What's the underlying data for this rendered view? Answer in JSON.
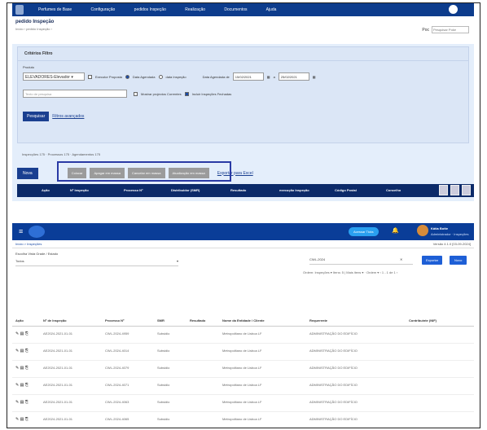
{
  "shot1": {
    "menu": [
      "Perfumes de Base",
      "Configuração",
      "pedidos Inspeção",
      "Realização",
      "Documentos",
      "Ajuda"
    ],
    "page_title": "pedido Inspeção",
    "breadcrumb": "Início › pedido Inspeção ›",
    "poc_label": "Poc",
    "poc_placeholder": "Pesquisar Poke",
    "criteria_title": "Critérios Filtro",
    "produto_label": "Produto",
    "produto_value": "ELEVADORES-Elevador",
    "radio_labels": [
      "Executor Proposta",
      "Data Agendada",
      "data Inspeção"
    ],
    "date_label": "Data Agendada de",
    "date_from": "15/02/2021",
    "date_sep": "a",
    "date_to": "25/02/2021",
    "search_placeholder": "Texto de pesquisa",
    "check_labels": [
      "Mostrar projectos Correntes",
      "Incluir Inspeções Fechadas"
    ],
    "search_button": "Pesquisar",
    "advanced_link": "Filtros avançados",
    "info_text": "Inspecções 175 · Processos 175 · Agendamentos 175",
    "nova_button": "Nova",
    "action_buttons": [
      "Colocar",
      "Apagar em massa",
      "Cancelar em massa",
      "Atualização em massa"
    ],
    "export_link": "Exportar para Excel",
    "columns": [
      "Ação",
      "Nº Inspeção",
      "Processo Nº",
      "Distribuidor (SMR)",
      "Resultado",
      "execução Inspeção",
      "Código Postal",
      "Concelho"
    ]
  },
  "shot2": {
    "account_button": "Acessar Ticks",
    "user_name": "Kátia Botte",
    "user_role": "Administrador · Inspeções",
    "breadcrumb": "Início > Inspeções",
    "version": "Versão 4.1.0 [03-09-2024]",
    "filter_label": "Escolha Vista Grade / Estado",
    "filter_value": "Todos",
    "process_value": "CWL-2024",
    "export_button": "Exportar",
    "new_button": "Novo",
    "pagination": "Ordem: Inspeções ▾  Itens: 5 | Mais itens ▾ · Ordem ▾  ‹ 1 - 1 de 1 ›",
    "columns": [
      "Ação",
      "Nº de Inspeção",
      "Processo Nº",
      "SMR",
      "Resultado",
      "Nome da Entidade / Cliente",
      "Requerente",
      "Contribuinte (NIF)"
    ],
    "rows": [
      [
        "AE2024-2021-01-01",
        "CWL-2024-4959",
        "Subsidio",
        "Metropolitano de Lisboa LF",
        "ADMINISTRAÇÃO DO EDIFÍCIO"
      ],
      [
        "AE2024-2021-01-01",
        "CWL-2024-4014",
        "Subsidio",
        "Metropolitano de Lisboa LF",
        "ADMINISTRAÇÃO DO EDIFÍCIO"
      ],
      [
        "AE2024-2021-01-01",
        "CWL-2024-4079",
        "Subsidio",
        "Metropolitano de Lisboa LF",
        "ADMINISTRAÇÃO DO EDIFÍCIO"
      ],
      [
        "AE2024-2021-01-01",
        "CWL-2024-4071",
        "Subsidio",
        "Metropolitano de Lisboa LF",
        "ADMINISTRAÇÃO DO EDIFÍCIO"
      ],
      [
        "AE2024-2021-01-01",
        "CWL-2024-4063",
        "Subsidio",
        "Metropolitano de Lisboa LF",
        "ADMINISTRAÇÃO DO EDIFÍCIO"
      ],
      [
        "AE2024-2021-01-01",
        "CWL-2024-4065",
        "Subsidio",
        "Metropolitano de Lisboa LF",
        "ADMINISTRAÇÃO DO EDIFÍCIO"
      ]
    ]
  },
  "colors": {
    "nav": "#0d3c8c",
    "panel": "#dbe6f6",
    "header": "#0c2a69",
    "accent": "#1e5fd6"
  }
}
